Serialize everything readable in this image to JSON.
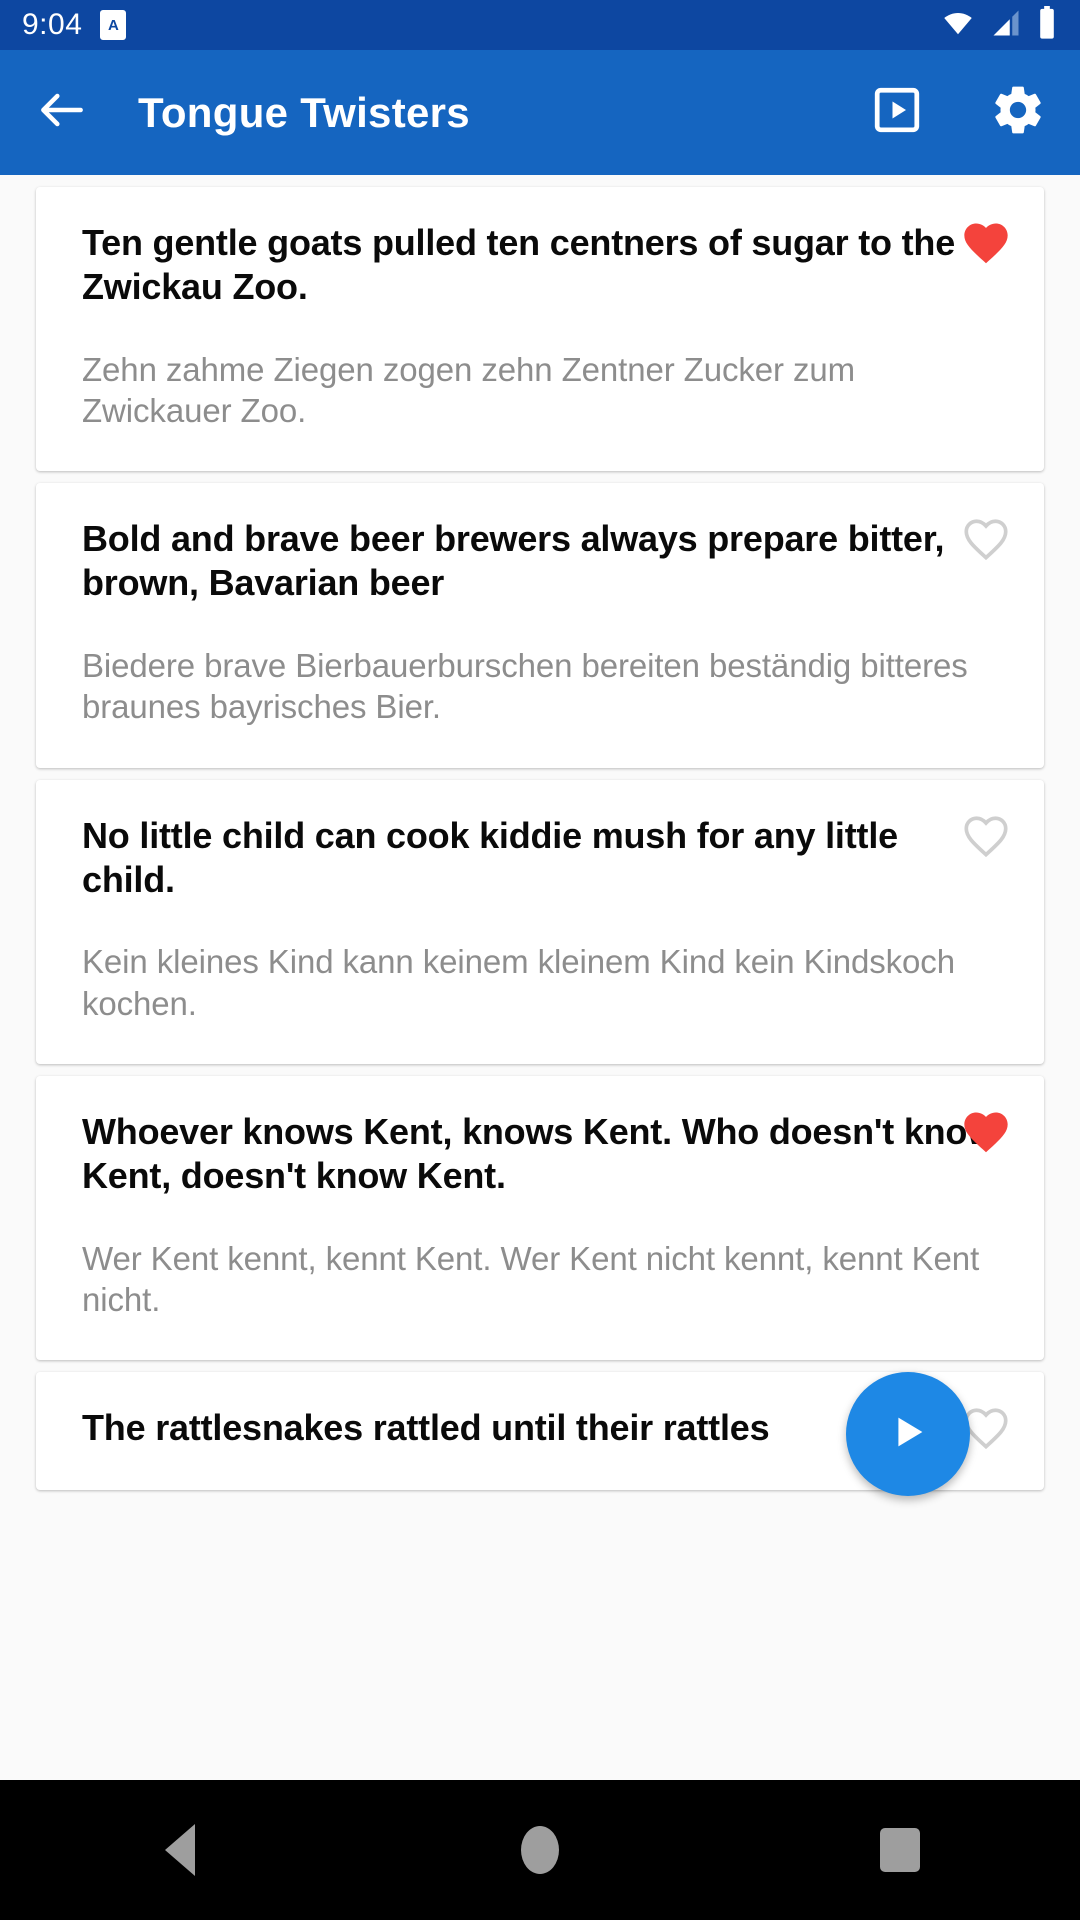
{
  "status_bar": {
    "clock": "9:04",
    "app_badge_letter": "A",
    "icons": [
      "wifi-icon",
      "cellular-signal-icon",
      "battery-icon"
    ]
  },
  "app_bar": {
    "back_icon": "back-arrow-icon",
    "title": "Tongue Twisters",
    "slideshow_icon": "slideshow-icon",
    "settings_icon": "gear-icon"
  },
  "colors": {
    "status_bar": "#0d47a1",
    "app_bar": "#1565c0",
    "fab": "#1e88e5",
    "favorite_active": "#f4433c",
    "favorite_inactive": "#cfcfcf",
    "card_bg": "#ffffff",
    "page_bg": "#fafafa",
    "title_text": "#0a0a0a",
    "subtitle_text": "#8d8d8d",
    "nav_bar": "#000000",
    "nav_icon": "#9e9e9e"
  },
  "fab": {
    "icon": "play-icon",
    "label": "Play"
  },
  "list": {
    "items": [
      {
        "title": "Ten gentle goats pulled ten centners of sugar to the Zwickau Zoo.",
        "subtitle": "Zehn zahme Ziegen zogen zehn Zentner Zucker zum Zwickauer Zoo.",
        "favorite": true
      },
      {
        "title": "Bold and brave beer brewers always prepare bitter, brown, Bavarian beer",
        "subtitle": "Biedere brave Bierbauerburschen bereiten beständig bitteres braunes bayrisches Bier.",
        "favorite": false
      },
      {
        "title": "No little child can cook kiddie mush for any little child.",
        "subtitle": "Kein kleines Kind kann keinem kleinem Kind kein Kindskoch kochen.",
        "favorite": false
      },
      {
        "title": "Whoever knows Kent, knows Kent. Who doesn't know Kent, doesn't know Kent.",
        "subtitle": "Wer Kent kennt, kennt Kent. Wer Kent nicht kennt, kennt Kent nicht.",
        "favorite": true
      },
      {
        "title": "The rattlesnakes rattled until their rattles",
        "subtitle": "",
        "favorite": false
      }
    ]
  },
  "nav_bar": {
    "back_label": "Back",
    "home_label": "Home",
    "recents_label": "Recents"
  }
}
